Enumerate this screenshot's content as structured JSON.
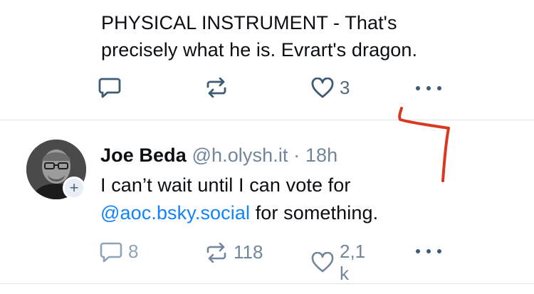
{
  "top_post": {
    "text": "PHYSICAL INSTRUMENT - That's\nprecisely what he is. Evrart's dragon.",
    "line1": "PHYSICAL INSTRUMENT - That's",
    "line2": "precisely what he is. Evrart's dragon.",
    "actions": {
      "reply_count": "",
      "repost_count": "",
      "like_count": "3"
    }
  },
  "post": {
    "author_name": "Joe Beda",
    "handle": "@h.olysh.it",
    "separator": "·",
    "time": "18h",
    "text_line1": "I can’t wait until I can vote for",
    "mention": "@aoc.bsky.social",
    "text_line2_rest": " for something.",
    "follow_glyph": "+",
    "actions": {
      "reply_count": "8",
      "repost_count": "118",
      "like_count": "2,1 k"
    }
  },
  "icons": {
    "reply": "speech-bubble-icon",
    "repost": "repost-arrows-icon",
    "like": "heart-icon",
    "more": "more-dots-icon"
  },
  "colors": {
    "text": "#0b0f14",
    "muted": "#71869c",
    "link": "#1083fe",
    "divider": "#dde3ea",
    "annotation": "#d93a1f"
  }
}
